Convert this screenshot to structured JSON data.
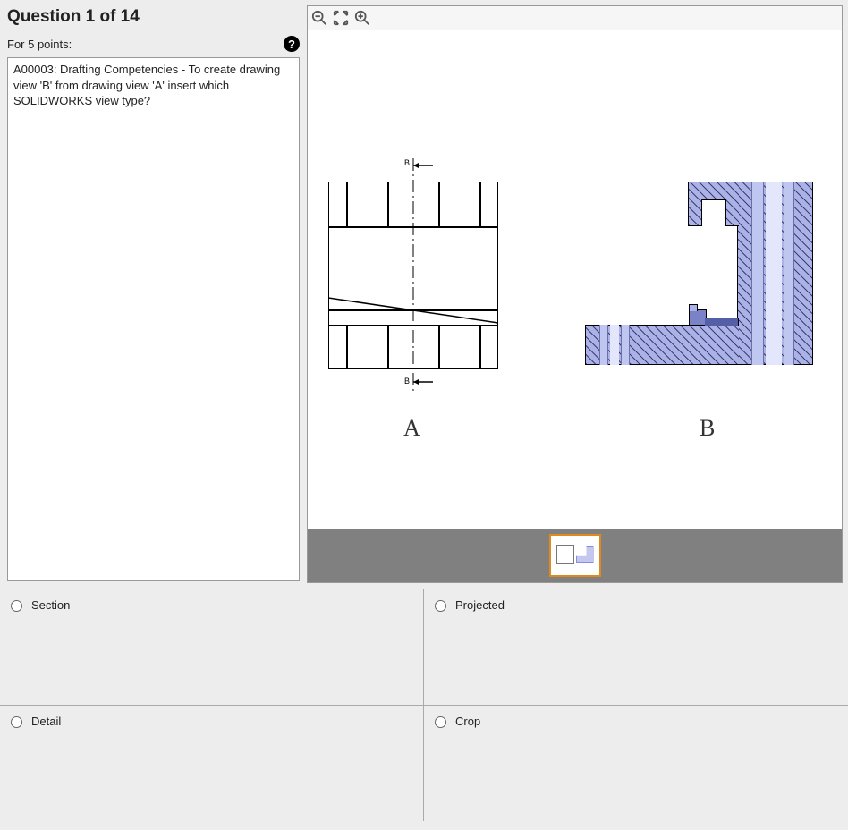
{
  "header": {
    "title": "Question 1 of 14",
    "points_text": "For 5 points:",
    "help_glyph": "?"
  },
  "prompt": "A00003:  Drafting Competencies - To create drawing view 'B' from drawing view 'A' insert which SOLIDWORKS view type?",
  "viewer": {
    "label_a": "A",
    "label_b": "B",
    "small_b_top": "B",
    "small_b_bottom": "B"
  },
  "answers": [
    {
      "id": "section",
      "label": "Section"
    },
    {
      "id": "projected",
      "label": "Projected"
    },
    {
      "id": "detail",
      "label": "Detail"
    },
    {
      "id": "crop",
      "label": "Crop"
    }
  ]
}
